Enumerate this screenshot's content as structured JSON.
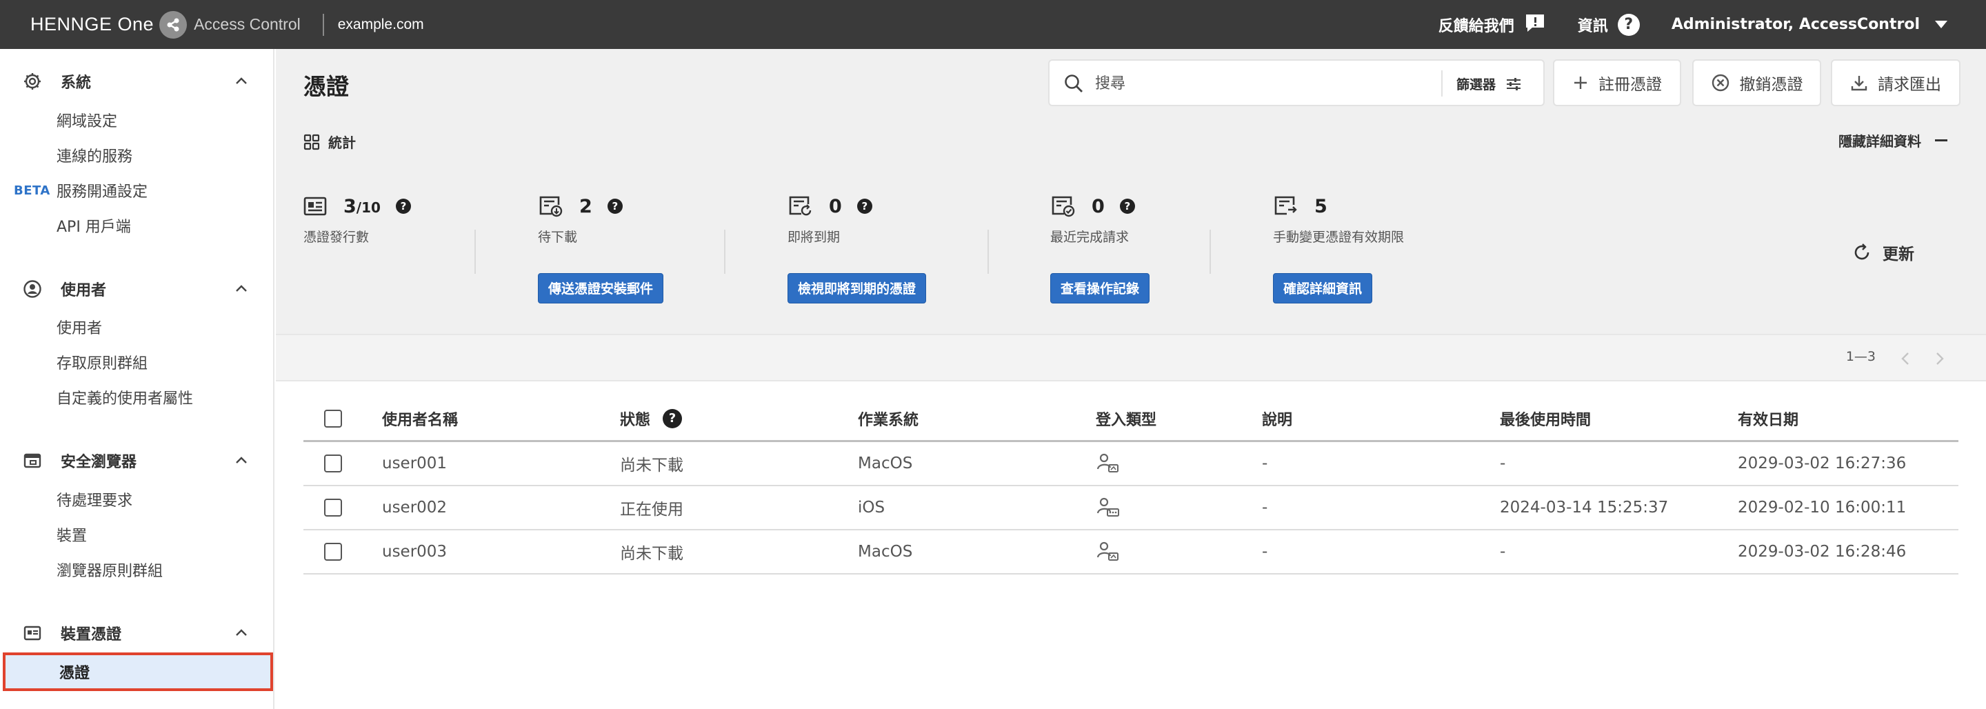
{
  "topbar": {
    "brand": "HENNGE One",
    "product": "Access Control",
    "domain": "example.com",
    "feedback": "反饋給我們",
    "info": "資訊",
    "user": "Administrator, AccessControl"
  },
  "sidebar": {
    "sections": [
      {
        "label": "系統",
        "icon": "gear-icon",
        "items": [
          "網域設定",
          "連線的服務",
          "服務開通設定",
          "API 用戶端"
        ],
        "badge": "BETA"
      },
      {
        "label": "使用者",
        "icon": "user-circle-icon",
        "items": [
          "使用者",
          "存取原則群組",
          "自定義的使用者屬性"
        ]
      },
      {
        "label": "安全瀏覽器",
        "icon": "browser-icon",
        "items": [
          "待處理要求",
          "裝置",
          "瀏覽器原則群組"
        ]
      },
      {
        "label": "裝置憑證",
        "icon": "certificate-icon",
        "items": [
          "憑證"
        ]
      }
    ],
    "active_item": "憑證"
  },
  "main": {
    "title": "憑證",
    "search_placeholder": "搜尋",
    "filter_label": "篩選器",
    "buttons": {
      "register": "註冊憑證",
      "revoke": "撤銷憑證",
      "export": "請求匯出"
    },
    "stats_label": "統計",
    "hide_details": "隱藏詳細資料",
    "refresh": "更新",
    "stats": [
      {
        "value": "3",
        "suffix": "/10",
        "desc": "憑證發行數",
        "help": true
      },
      {
        "value": "2",
        "desc": "待下載",
        "help": true,
        "button": "傳送憑證安裝郵件"
      },
      {
        "value": "0",
        "desc": "即將到期",
        "help": true,
        "button": "檢視即將到期的憑證"
      },
      {
        "value": "0",
        "desc": "最近完成請求",
        "help": true,
        "button": "查看操作記錄"
      },
      {
        "value": "5",
        "desc": "手動變更憑證有效期限",
        "help": false,
        "button": "確認詳細資訊"
      }
    ],
    "pagination": "1—3",
    "table": {
      "headers": [
        "使用者名稱",
        "狀態",
        "作業系統",
        "登入類型",
        "說明",
        "最後使用時間",
        "有效日期"
      ],
      "rows": [
        {
          "user": "user001",
          "status": "尚未下載",
          "os": "MacOS",
          "desc": "-",
          "last_used": "-",
          "expiry": "2029-03-02 16:27:36"
        },
        {
          "user": "user002",
          "status": "正在使用",
          "os": "iOS",
          "desc": "-",
          "last_used": "2024-03-14 15:25:37",
          "expiry": "2029-02-10 16:00:11"
        },
        {
          "user": "user003",
          "status": "尚未下載",
          "os": "MacOS",
          "desc": "-",
          "last_used": "-",
          "expiry": "2029-03-02 16:28:46"
        }
      ]
    }
  }
}
